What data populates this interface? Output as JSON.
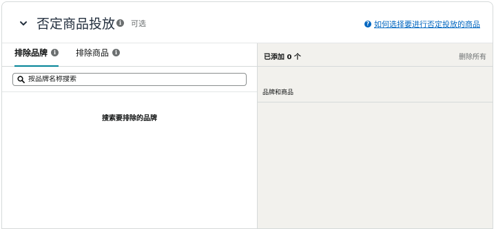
{
  "header": {
    "title": "否定商品投放",
    "optional": "可选",
    "help_link": "如何选择要进行否定投放的商品"
  },
  "tabs": [
    {
      "label": "排除品牌",
      "active": true
    },
    {
      "label": "排除商品",
      "active": false
    }
  ],
  "search": {
    "placeholder": "按品牌名称搜索",
    "value": ""
  },
  "left_empty_text": "搜索要排除的品牌",
  "right_panel": {
    "added_label": "已添加 0 个",
    "remove_all": "删除所有",
    "column_label": "品牌和商品"
  },
  "colors": {
    "accent": "#008296",
    "link": "#0066c0",
    "right_bg": "#f2f1ed"
  }
}
